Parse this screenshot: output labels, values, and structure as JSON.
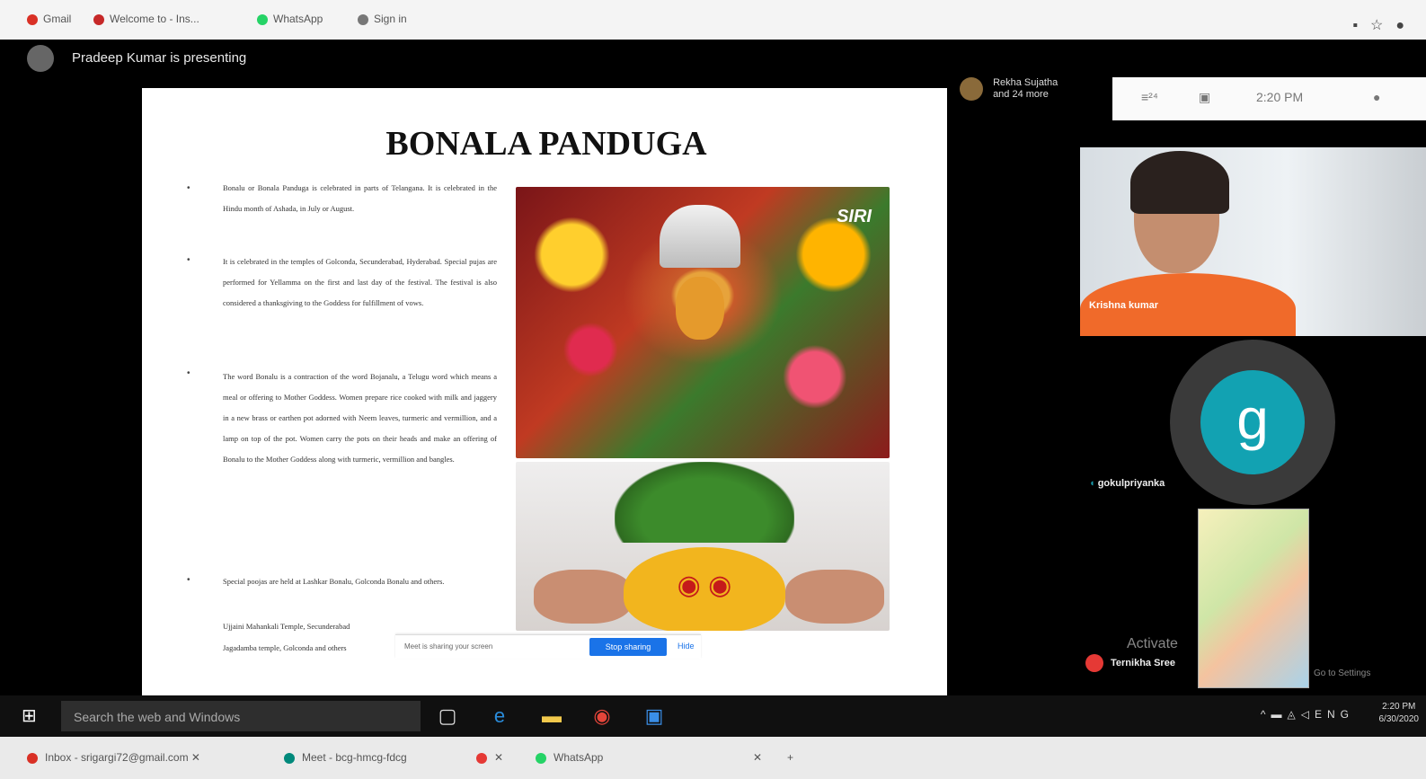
{
  "browser_top": {
    "bookmarks": [
      "Gmail",
      "Welcome to - Ins...",
      "WhatsApp",
      "Sign in"
    ],
    "right_icons": [
      "cast-icon",
      "star-icon",
      "extension-icon"
    ]
  },
  "meet": {
    "presenting_text": "Pradeep Kumar is presenting",
    "speaker_name": "Rekha Sujatha",
    "speaker_sub": "and 24 more",
    "clock": "2:20 PM",
    "participants": [
      {
        "label": "Krishna kumar"
      },
      {
        "initial": "g",
        "label": "gokulpriyanka"
      },
      {
        "label": "Ternikha Sree"
      }
    ],
    "watermark": "Activate",
    "watermark_sub": "Go to Settings"
  },
  "slide": {
    "title": "BONALA PANDUGA",
    "image_logo": "SIRI",
    "paragraphs": [
      "Bonalu or Bonala Panduga is celebrated in parts of Telangana. It is celebrated in the Hindu month of Ashada, in July or August.",
      "It is celebrated in the temples of Golconda, Secunderabad, Hyderabad. Special pujas are performed for Yellamma on the first and last day of the festival. The festival is also considered a thanksgiving to the Goddess for fulfillment of vows.",
      "The word Bonalu is a contraction of the word Bojanalu, a Telugu word which means a meal or offering to Mother Goddess. Women prepare rice cooked with milk and jaggery in a new brass or earthen pot adorned with Neem leaves, turmeric and vermillion, and a lamp on top of the pot. Women carry the pots on their heads and make an offering of Bonalu to the Mother Goddess along with turmeric, vermillion and bangles.",
      "Special poojas are held at Lashkar Bonalu, Golconda Bonalu and others."
    ],
    "trailing_lines": [
      "Ujjaini Mahankali Temple, Secunderabad",
      "Jagadamba temple, Golconda and others"
    ],
    "share_message": "Meet is sharing your screen",
    "share_stop": "Stop sharing",
    "share_hide": "Hide"
  },
  "taskbar": {
    "search_placeholder": "Search the web and Windows",
    "tray_lang": "ENG",
    "clock_time": "2:20 PM",
    "clock_date": "6/30/2020"
  },
  "browser_bottom": {
    "tabs": [
      "Inbox - srigargi72@gmail.com",
      "Meet - bcg-hmcg-fdcg",
      "WhatsApp"
    ]
  },
  "colors": {
    "accent": "#1a73e8",
    "avatar_teal": "#12a2b2",
    "badge_red": "#e53935"
  }
}
